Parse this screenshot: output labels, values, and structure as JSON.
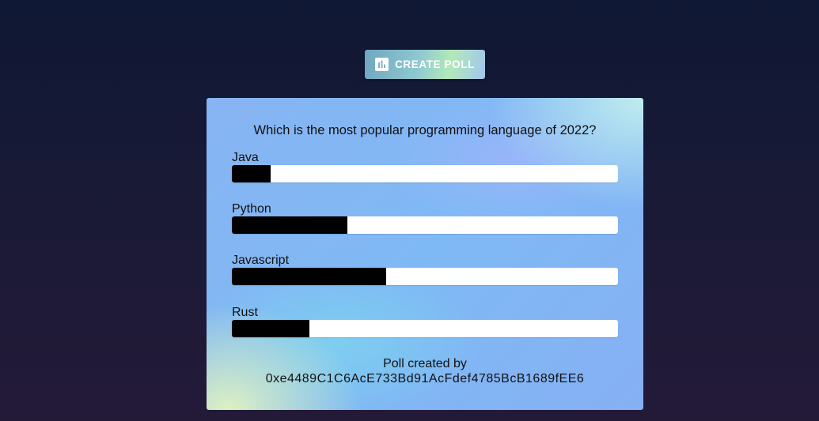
{
  "create_button": {
    "label": "CREATE POLL",
    "icon": "bar-chart-icon"
  },
  "poll": {
    "question": "Which is the most popular programming language of 2022?",
    "options": [
      {
        "label": "Java",
        "fraction": 0.1
      },
      {
        "label": "Python",
        "fraction": 0.3
      },
      {
        "label": "Javascript",
        "fraction": 0.4
      },
      {
        "label": "Rust",
        "fraction": 0.2
      }
    ],
    "footer": {
      "created_by": "Poll created by",
      "address": "0xe4489C1C6AcE733Bd91AcFdef4785BcB1689fEE6"
    }
  },
  "colors": {
    "fill": "#000000",
    "track": "#ffffff",
    "background": "#0f1834"
  }
}
